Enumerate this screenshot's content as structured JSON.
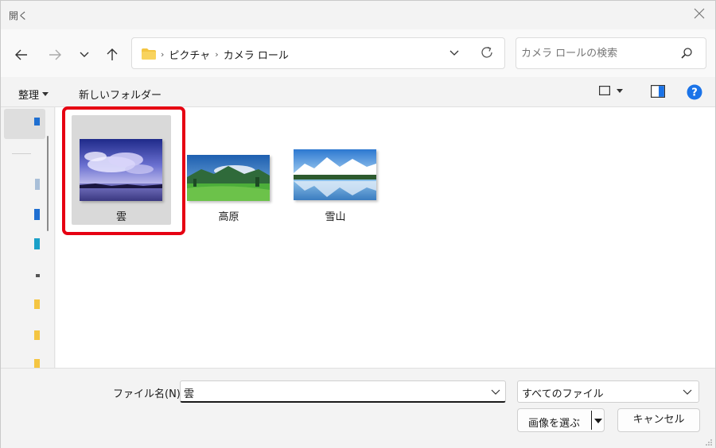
{
  "window": {
    "title": "開く"
  },
  "address": {
    "crumbs": [
      "ピクチャ",
      "カメラ ロール"
    ]
  },
  "search": {
    "placeholder": "カメラ ロールの検索"
  },
  "toolbar": {
    "organize": "整理",
    "new_folder": "新しいフォルダー"
  },
  "files": [
    {
      "name": "雲",
      "selected": true
    },
    {
      "name": "高原",
      "selected": false
    },
    {
      "name": "雪山",
      "selected": false
    }
  ],
  "bottom": {
    "filename_label": "ファイル名(N):",
    "filename_value": "雲",
    "filter_value": "すべてのファイル",
    "open_label": "画像を選ぶ",
    "cancel_label": "キャンセル"
  },
  "colors": {
    "highlight": "#e60012",
    "folder": "#f4c542",
    "help": "#1a73e8",
    "accent": "#0078d4"
  }
}
